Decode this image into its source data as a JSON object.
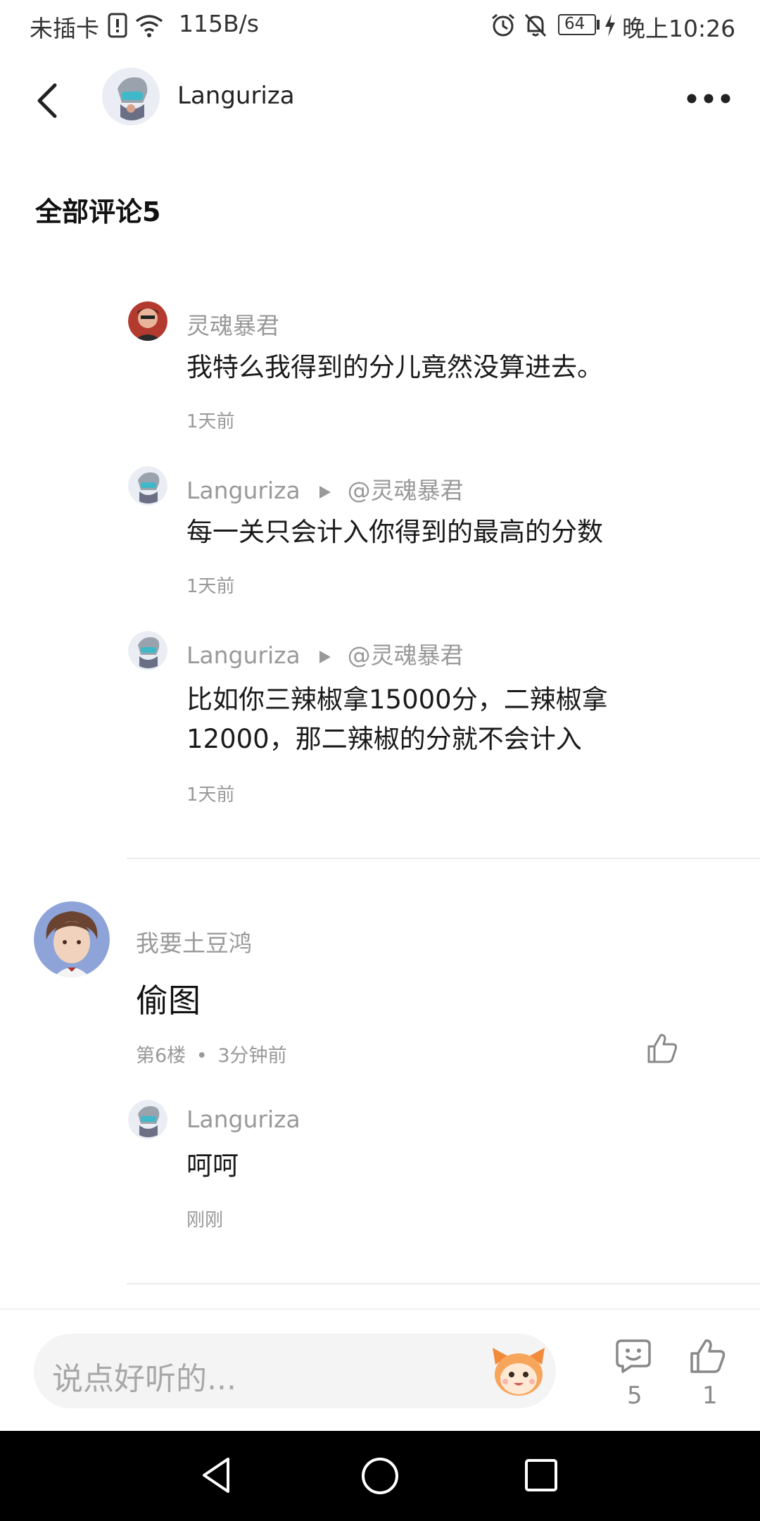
{
  "status_bar": {
    "carrier": "未插卡",
    "speed": "115B/s",
    "battery": "64",
    "time": "晚上10:26"
  },
  "header": {
    "username": "Languriza"
  },
  "comments_title": "全部评论5",
  "replies_top": [
    {
      "user": "灵魂暴君",
      "reply_to": "",
      "content": "我特么我得到的分儿竟然没算进去。",
      "time": "1天前"
    },
    {
      "user": "Languriza",
      "reply_to": "@灵魂暴君",
      "content": "每一关只会计入你得到的最高的分数",
      "time": "1天前"
    },
    {
      "user": "Languriza",
      "reply_to": "@灵魂暴君",
      "content_line1": "比如你三辣椒拿15000分，二辣椒拿",
      "content_line2": "12000，那二辣椒的分就不会计入",
      "time": "1天前"
    }
  ],
  "main_comment": {
    "user": "我要土豆鸿",
    "content": "偷图",
    "floor": "第6楼",
    "time": "3分钟前"
  },
  "reply_bottom": {
    "user": "Languriza",
    "content": "呵呵",
    "time": "刚刚"
  },
  "bottom_bar": {
    "placeholder": "说点好听的...",
    "comment_count": "5",
    "like_count": "1"
  },
  "icons": {
    "back": "back-arrow-icon",
    "more": "more-dots-icon",
    "like": "thumbs-up-icon",
    "comment": "comment-bubble-icon",
    "emoji": "emoji-mascot-icon"
  },
  "colors": {
    "secondary_text": "#999999",
    "divider": "#ececec",
    "input_bg": "#f4f4f4"
  }
}
